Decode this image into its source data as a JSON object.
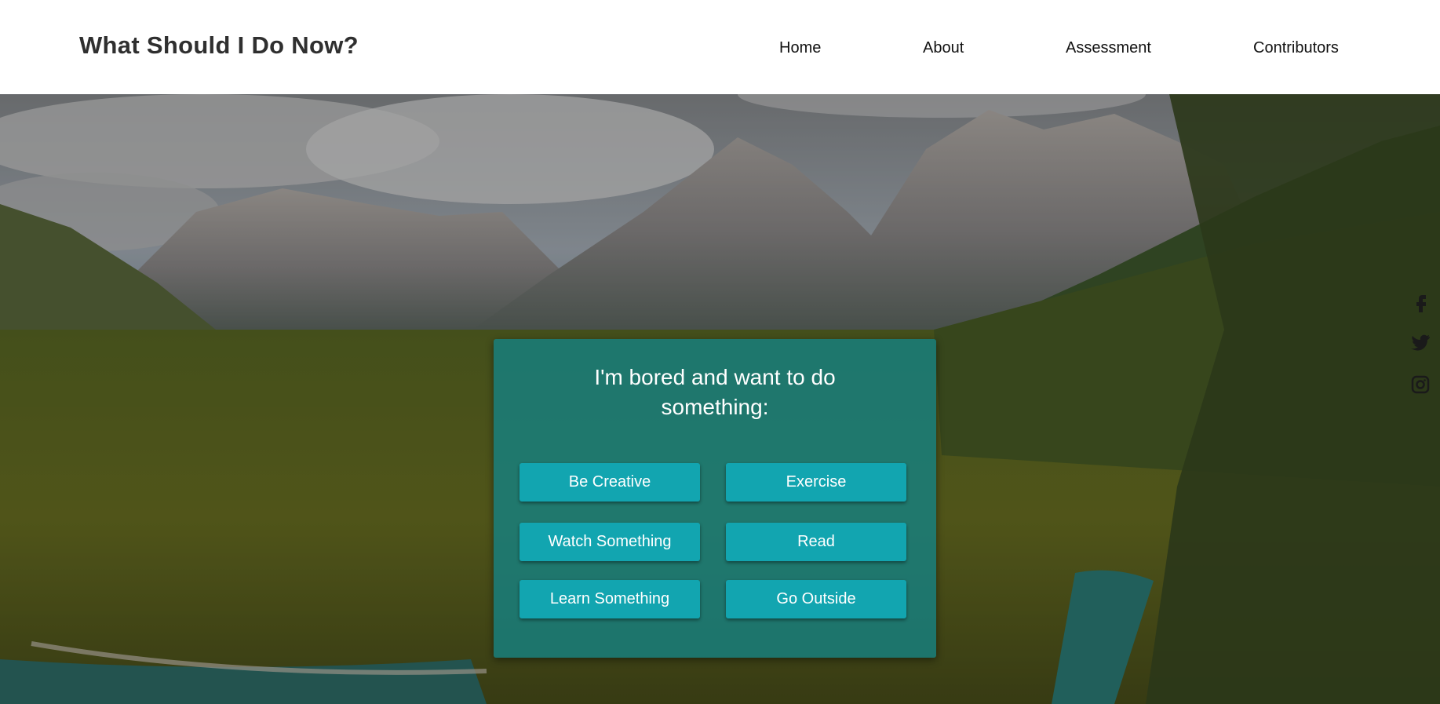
{
  "header": {
    "site_title": "What Should I Do Now?",
    "nav": [
      {
        "label": "Home"
      },
      {
        "label": "About"
      },
      {
        "label": "Assessment"
      },
      {
        "label": "Contributors"
      }
    ]
  },
  "card": {
    "title": "I'm bored and want to do something:",
    "options": [
      {
        "label": "Be Creative"
      },
      {
        "label": "Exercise"
      },
      {
        "label": "Watch Something"
      },
      {
        "label": "Read"
      },
      {
        "label": "Learn Something"
      },
      {
        "label": "Go Outside"
      }
    ]
  },
  "social": {
    "icons": [
      "facebook-icon",
      "twitter-icon",
      "instagram-icon"
    ]
  },
  "colors": {
    "card_background": "#168080",
    "button_background": "#12a5b0",
    "title_text": "#2f2f2f"
  }
}
